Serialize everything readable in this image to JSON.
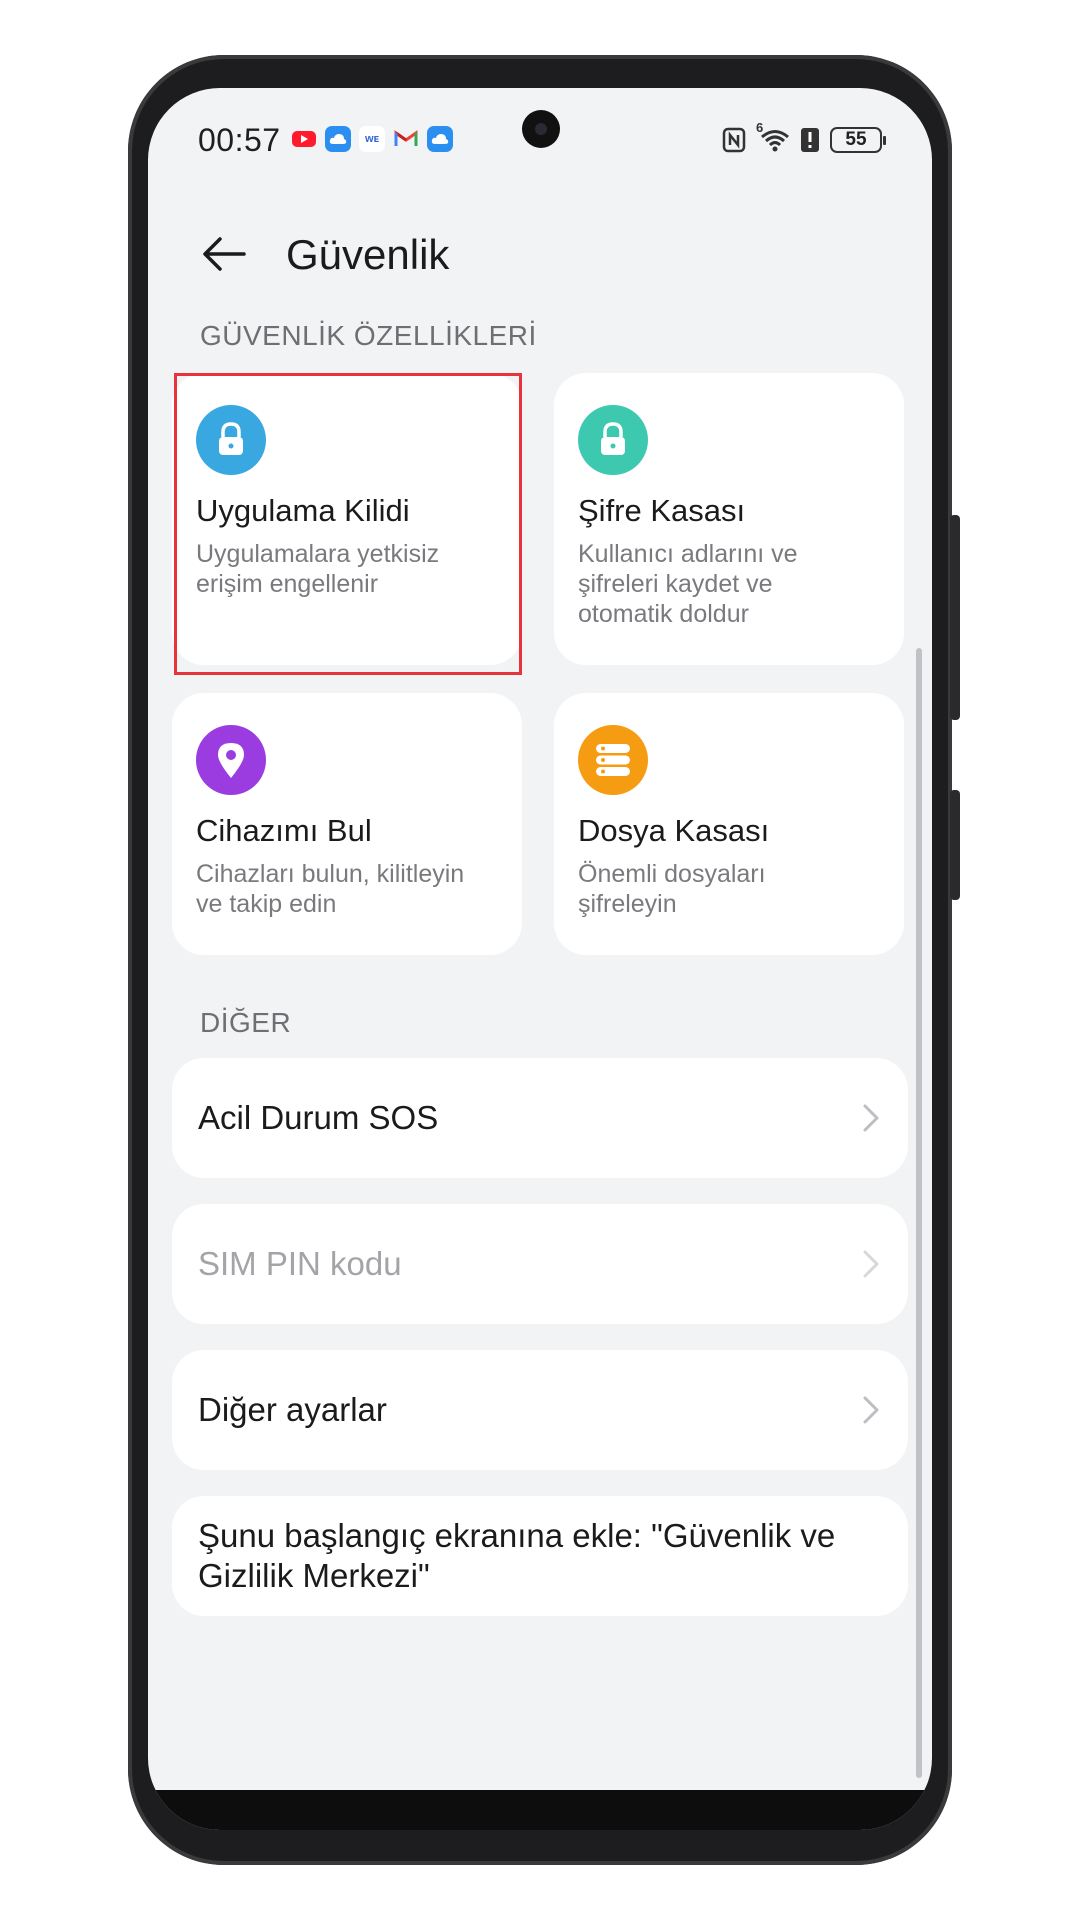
{
  "status_bar": {
    "time": "00:57",
    "network_type": "6",
    "battery_level": "55",
    "notification_icons": [
      "youtube-icon",
      "cloud-icon",
      "messenger-icon",
      "gmail-icon",
      "cloud-icon"
    ]
  },
  "header": {
    "title": "Güvenlik"
  },
  "sections": {
    "features_label": "GÜVENLİK ÖZELLİKLERİ",
    "other_label": "DİĞER"
  },
  "tiles": [
    {
      "title": "Uygulama Kilidi",
      "desc": "Uygulamalara yetkisiz erişim engellenir",
      "icon": "lock-icon",
      "color": "#3aa8e0"
    },
    {
      "title": "Şifre Kasası",
      "desc": "Kullanıcı adlarını ve şifreleri kaydet ve otomatik doldur",
      "icon": "lock-icon",
      "color": "#3dc8b0"
    },
    {
      "title": "Cihazımı Bul",
      "desc": "Cihazları bulun, kilitleyin ve takip edin",
      "icon": "location-pin-icon",
      "color": "#9b3ce0"
    },
    {
      "title": "Dosya Kasası",
      "desc": "Önemli dosyaları şifreleyin",
      "icon": "storage-icon",
      "color": "#f59c12"
    }
  ],
  "rows": [
    {
      "label": "Acil Durum SOS",
      "enabled": true
    },
    {
      "label": "SIM PIN kodu",
      "enabled": false
    },
    {
      "label": "Diğer ayarlar",
      "enabled": true
    },
    {
      "label": "Şunu başlangıç ekranına ekle: \"Güvenlik ve Gizlilik Merkezi\"",
      "enabled": true
    }
  ],
  "colors": {
    "background": "#f2f3f5",
    "card": "#ffffff",
    "highlight": "#e8333c"
  }
}
